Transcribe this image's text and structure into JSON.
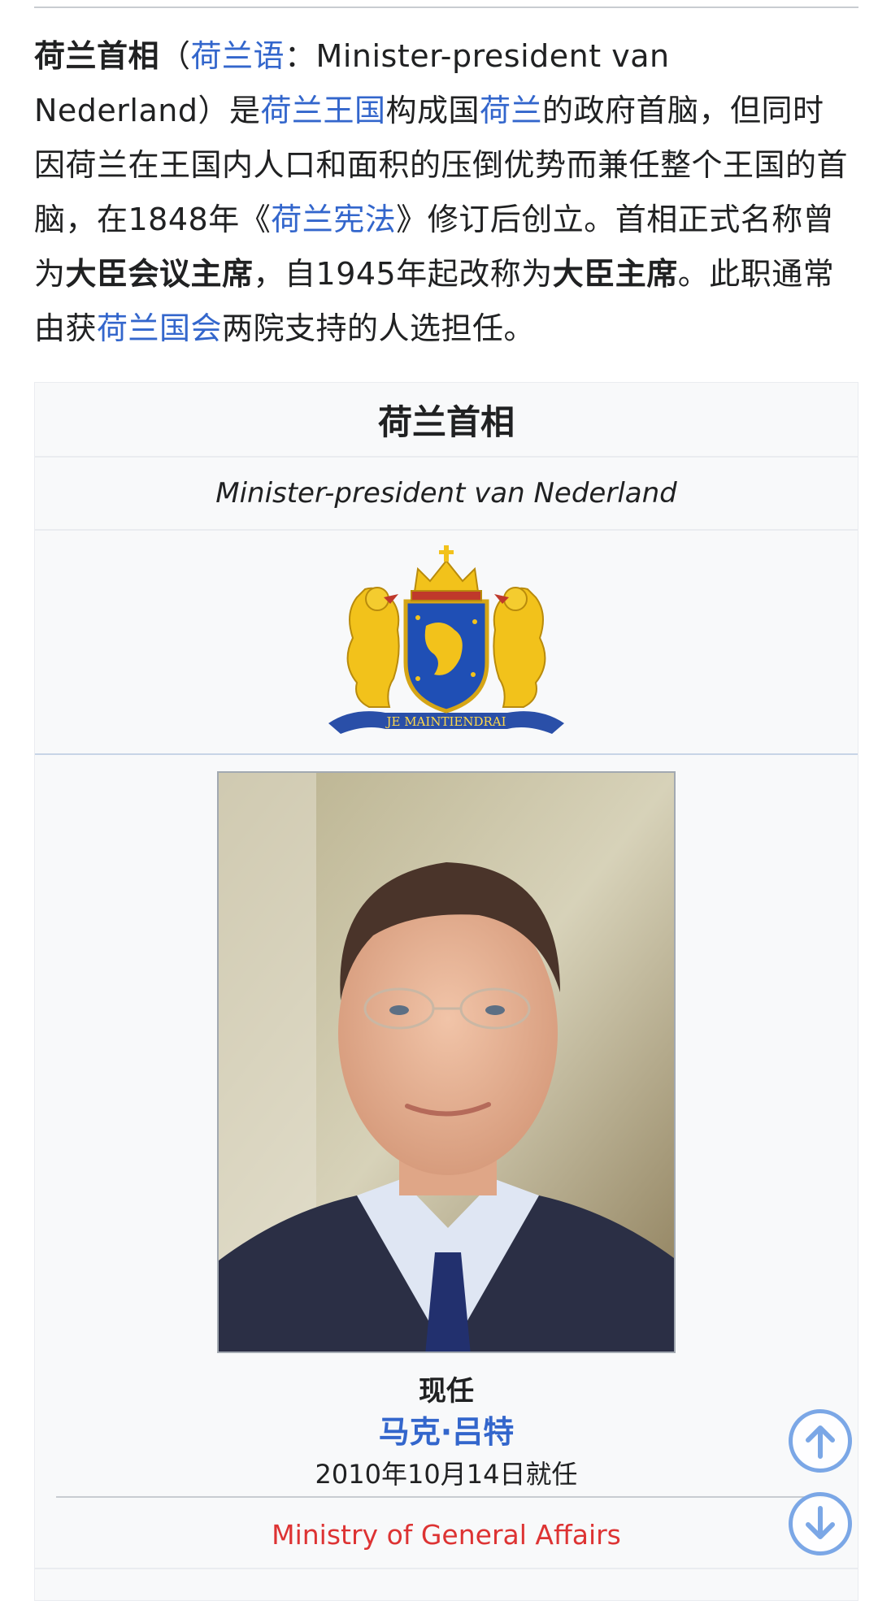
{
  "intro": {
    "title_bold": "荷兰首相",
    "paren_open": "（",
    "lang_link": "荷兰语",
    "colon_text": "：Minister-president van Nederland）是",
    "link_kingdom": "荷兰王国",
    "text_constituent": "构成国",
    "link_nl": "荷兰",
    "text_mid": "的政府首脑，但同时因荷兰在王国内人口和面积的压倒优势而兼任整个王国的首脑，在1848年《",
    "link_constitution": "荷兰宪法",
    "text_after_const": "》修订后创立。首相正式名称曾为",
    "bold_old_name": "大臣会议主席",
    "text_since": "，自1945年起改称为",
    "bold_new_name": "大臣主席",
    "text_support": "。此职通常由获",
    "link_parliament": "荷兰国会",
    "text_end": "两院支持的人选担任。"
  },
  "infobox": {
    "title": "荷兰首相",
    "subtitle": "Minister-president van Nederland",
    "emblem_motto": "JE MAINTIENDRAI",
    "incumbent_label": "现任",
    "incumbent_name": "马克·吕特",
    "incumbent_since": "2010年10月14日就任",
    "ministry": "Ministry of General Affairs"
  },
  "colors": {
    "link": "#3366cc",
    "red_link": "#dd3333",
    "fab": "#7ba7e6"
  },
  "icons": {
    "scroll_up": "arrow-up-circle-icon",
    "scroll_down": "arrow-down-circle-icon"
  }
}
